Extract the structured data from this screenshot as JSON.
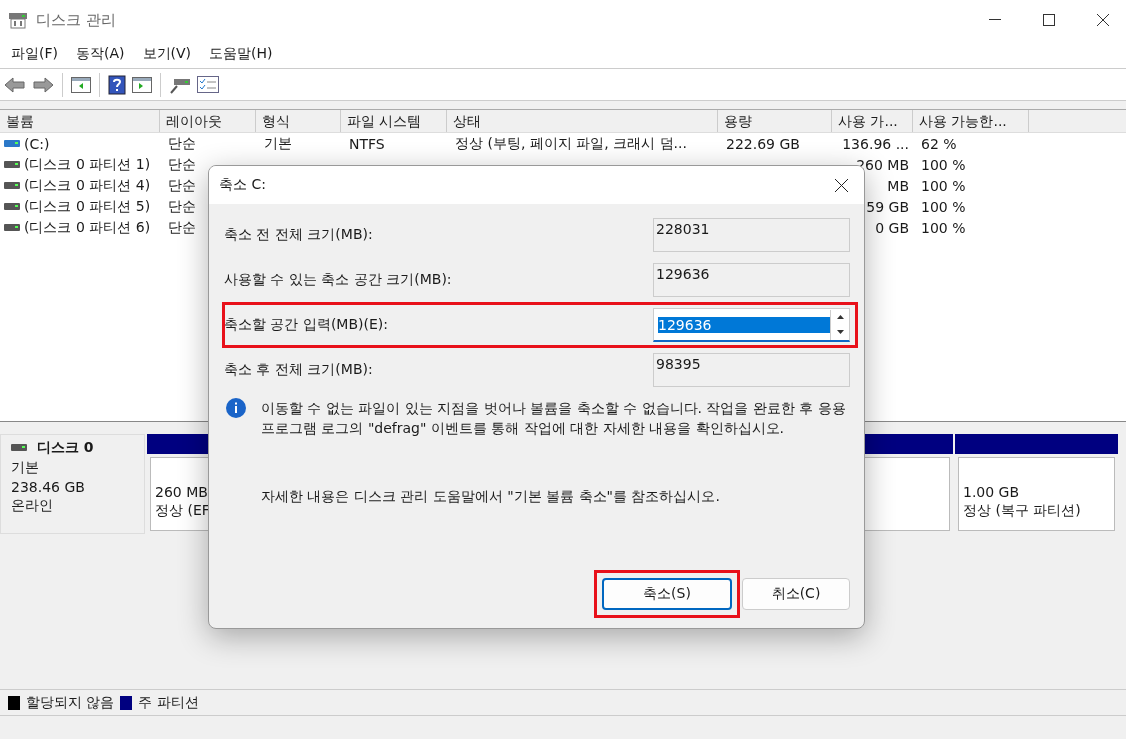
{
  "window": {
    "title": "디스크 관리"
  },
  "menu": [
    "파일(F)",
    "동작(A)",
    "보기(V)",
    "도움말(H)"
  ],
  "table": {
    "columns": [
      "볼륨",
      "레이아웃",
      "형식",
      "파일 시스템",
      "상태",
      "용량",
      "사용 가...",
      "사용 가능한..."
    ],
    "rows": [
      {
        "kind": "system",
        "cells": [
          "(C:)",
          "단순",
          "기본",
          "NTFS",
          "정상 (부팅, 페이지 파일, 크래시 덤...",
          "222.69 GB",
          "136.96 ...",
          "62 %"
        ]
      },
      {
        "kind": "partition",
        "cells": [
          "(디스크 0 파티션 1)",
          "단순",
          null,
          null,
          null,
          null,
          "260 MB",
          "100 %"
        ]
      },
      {
        "kind": "partition",
        "cells": [
          "(디스크 0 파티션 4)",
          "단순",
          null,
          null,
          null,
          null,
          "MB",
          "100 %"
        ]
      },
      {
        "kind": "partition",
        "cells": [
          "(디스크 0 파티션 5)",
          "단순",
          null,
          null,
          null,
          null,
          "59 GB",
          "100 %"
        ]
      },
      {
        "kind": "partition",
        "cells": [
          "(디스크 0 파티션 6)",
          "단순",
          null,
          null,
          null,
          null,
          "0 GB",
          "100 %"
        ]
      }
    ]
  },
  "disk": {
    "name": "디스크 0",
    "type": "기본",
    "size": "238.46 GB",
    "status": "온라인",
    "partitions": [
      {
        "kind": "primary",
        "lines": [
          "260 MB",
          "정상 (EF"
        ]
      },
      {
        "kind": "primary"
      },
      {
        "kind": "primary",
        "lines": [
          "1.00 GB",
          "정상 (복구 파티션)"
        ]
      }
    ]
  },
  "legend": [
    {
      "label": "할당되지 않음",
      "color": "#000000"
    },
    {
      "label": "주 파티션",
      "color": "#000080"
    }
  ],
  "dialog": {
    "title": "축소 C:",
    "fields": [
      {
        "kind": "readonly",
        "label": "축소 전 전체 크기(MB):",
        "value": "228031",
        "highlighted": false
      },
      {
        "kind": "readonly",
        "label": "사용할 수 있는 축소 공간 크기(MB):",
        "value": "129636",
        "highlighted": false
      },
      {
        "kind": "spin",
        "label": "축소할 공간 입력(MB)(E):",
        "value": "129636",
        "highlighted": true
      },
      {
        "kind": "readonly",
        "label": "축소 후 전체 크기(MB):",
        "value": "98395",
        "highlighted": false
      }
    ],
    "info": "이동할 수 없는 파일이 있는 지점을 벗어나 볼륨을 축소할 수 없습니다. 작업을 완료한 후 응용 프로그램 로그의 \"defrag\" 이벤트를 통해 작업에 대한 자세한 내용을 확인하십시오.",
    "help": "자세한 내용은 디스크 관리 도움말에서 \"기본 볼륨 축소\"를 참조하십시오.",
    "buttons": [
      {
        "label": "축소(S)",
        "default": true,
        "highlighted": true
      },
      {
        "label": "취소(C)",
        "default": false,
        "highlighted": false
      }
    ]
  }
}
